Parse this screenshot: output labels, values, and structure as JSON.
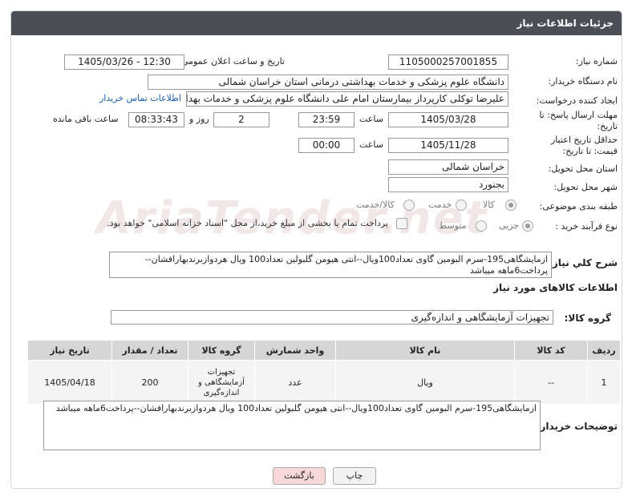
{
  "header": {
    "title": "جزئیات اطلاعات نیاز"
  },
  "labels": {
    "need_number": "شماره نیاز:",
    "announce_datetime": "تاریخ و ساعت اعلان عمومی:",
    "buyer_org": "نام دستگاه خریدار:",
    "requester": "ایجاد کننده درخواست:",
    "reply_deadline": "مهلت ارسال پاسخ: تا تاریخ:",
    "hour": "ساعت",
    "day_and": "روز و",
    "hours_remaining": "ساعت باقی مانده",
    "price_validity": "حداقل تاریخ اعتبار قیمت: تا تاریخ:",
    "delivery_province": "استان محل تحویل:",
    "delivery_city": "شهر محل تحویل:",
    "category": "طبقه بندی موضوعی:",
    "process_type": "نوع فرآیند خرید :",
    "description": "شرح کلي نياز:",
    "items_info": "اطلاعات کالاهای مورد نیاز",
    "goods_group": "گروه کالا:",
    "buyer_notes": "توضیحات خریدار:"
  },
  "values": {
    "need_number": "1105000257001855",
    "announce_datetime": "1405/03/26 - 12:30",
    "buyer_org": "دانشگاه علوم پزشکی و خدمات بهداشتی درمانی استان خراسان شمالی",
    "requester": "علیرضا توکلی کارپرداز بیمارستان امام علی دانشگاه علوم پزشکی و خدمات بهدا",
    "contact_link": "اطلاعات تماس خریدار",
    "reply_date": "1405/03/28",
    "reply_time": "23:59",
    "days": "2",
    "remaining": "08:33:43",
    "validity_date": "1405/11/28",
    "validity_time": "00:00",
    "province": "خراسان شمالی",
    "city": "بجنورد",
    "category_options": [
      "کالا",
      "خدمت",
      "کالا/خدمت"
    ],
    "category_selected": "کالا",
    "process_options": [
      "جزیی",
      "متوسط"
    ],
    "process_selected": "جزیی",
    "payment_note": "پرداخت تمام یا بخشی از مبلغ خرید،از محل \"اسناد خزانه اسلامی\" خواهد بود.",
    "description": "ازمایشگاهی195-سرم البومین گاوی تعداد100ویال--انتی هیومن گلبولین تعداد100 ویال هردوازبرندبهارافشان--پرداخت6ماهه میباشد",
    "goods_group": "تجهیزات آزمایشگاهی و اندازه‌گیری",
    "buyer_notes": "ازمایشگاهی195-سرم البومین گاوی تعداد100ویال--انتی هیومن گلبولین تعداد100 ویال هردوازبرندبهارافشان--پرداخت6ماهه میباشد"
  },
  "table": {
    "headers": [
      "ردیف",
      "کد کالا",
      "نام کالا",
      "واحد شمارش",
      "گروه کالا",
      "تعداد / مقدار",
      "تاریخ نیاز"
    ],
    "rows": [
      [
        "1",
        "--",
        "ویال",
        "عدد",
        "تجهیزات آزمایشگاهی و اندازه‌گیری",
        "200",
        "1405/04/18"
      ]
    ]
  },
  "buttons": {
    "print": "چاپ",
    "back": "بازگشت"
  },
  "watermark": "AriaTender.net",
  "colors": {
    "header_bg": "#4a4f56",
    "link": "#1a5fb4",
    "back_button_bg": "#f7d7d7"
  }
}
